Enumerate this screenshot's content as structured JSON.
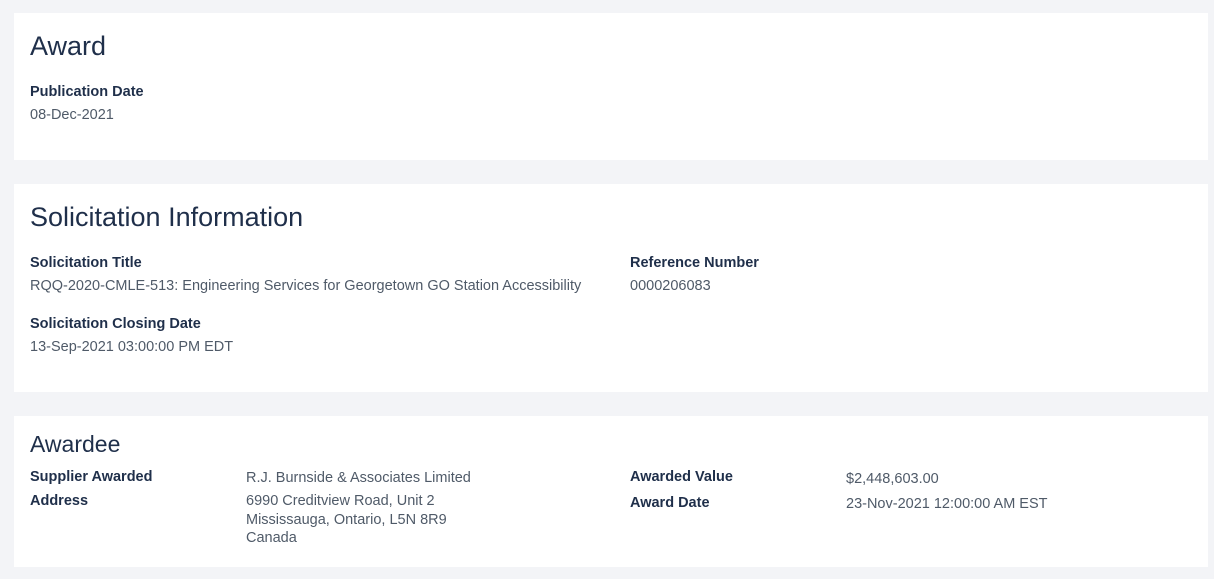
{
  "award": {
    "heading": "Award",
    "publication_date_label": "Publication Date",
    "publication_date": "08-Dec-2021"
  },
  "solicitation": {
    "heading": "Solicitation Information",
    "title_label": "Solicitation Title",
    "title": "RQQ-2020-CMLE-513: Engineering Services for Georgetown GO Station Accessibility",
    "reference_label": "Reference Number",
    "reference": "0000206083",
    "closing_label": "Solicitation Closing Date",
    "closing": "13-Sep-2021 03:00:00 PM EDT"
  },
  "awardee": {
    "heading": "Awardee",
    "supplier_label": "Supplier Awarded",
    "supplier": "R.J. Burnside & Associates Limited",
    "address_label": "Address",
    "address_lines": [
      "6990 Creditview Road, Unit 2",
      "Mississauga, Ontario, L5N 8R9",
      "Canada"
    ],
    "value_label": "Awarded Value",
    "value": "$2,448,603.00",
    "award_date_label": "Award Date",
    "award_date": "23-Nov-2021 12:00:00 AM EST"
  }
}
